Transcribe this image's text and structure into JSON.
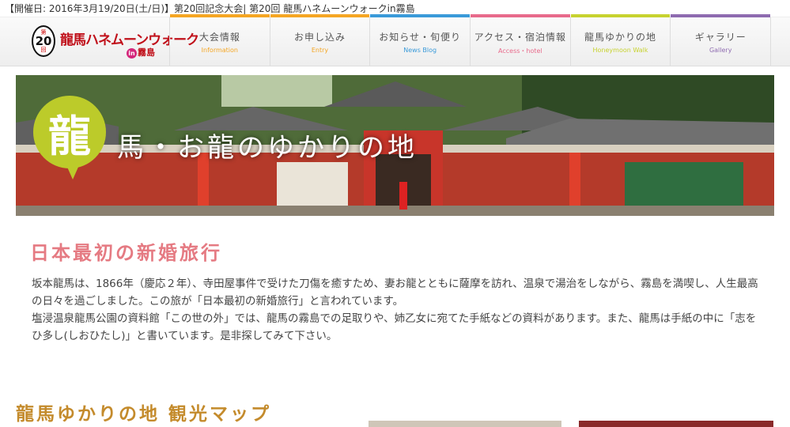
{
  "topbar": {
    "text": "【開催日: 2016年3月19/20日(土/日)】第20回記念大会| 第20回 龍馬ハネムーンウォークin霧島"
  },
  "logo": {
    "badge_top": "第",
    "badge_num": "20",
    "badge_bottom": "回",
    "title": "龍馬ハネムーンウォーク",
    "sub_in": "in",
    "sub_place": "霧島"
  },
  "nav": [
    {
      "label": "大会情報",
      "sub": "Information",
      "color": "#f5a623"
    },
    {
      "label": "お申し込み",
      "sub": "Entry",
      "color": "#f5a623"
    },
    {
      "label": "お知らせ・旬便り",
      "sub": "News  Blog",
      "color": "#3a9ad9"
    },
    {
      "label": "アクセス・宿泊情報",
      "sub": "Access・hotel",
      "color": "#e86a8b"
    },
    {
      "label": "龍馬ゆかりの地",
      "sub": "Honeymoon Walk",
      "color": "#c7d22f"
    },
    {
      "label": "ギャラリー",
      "sub": "Gallery",
      "color": "#8e6bb0"
    }
  ],
  "hero": {
    "kanji": "龍",
    "title": "馬・お龍のゆかりの地"
  },
  "section": {
    "title": "日本最初の新婚旅行",
    "paragraphs": [
      "坂本龍馬は、1866年（慶応２年）、寺田屋事件で受けた刀傷を癒すため、妻お龍とともに薩摩を訪れ、温泉で湯治をしながら、霧島を満喫し、人生最高の日々を過ごしました。この旅が「日本最初の新婚旅行」と言われています。",
      "塩浸温泉龍馬公園の資料館「この世の外」では、龍馬の霧島での足取りや、姉乙女に宛てた手紙などの資料があります。また、龍馬は手紙の中に「志をひ多し(しおひたし)」と書いています。是非探してみて下さい。"
    ]
  },
  "map": {
    "title": "龍馬ゆかりの地 観光マップ"
  },
  "colors": {
    "accent_pink": "#e57a82",
    "accent_gold": "#c48b2c",
    "bubble": "#bccb2a",
    "brand_red": "#c0101a"
  }
}
